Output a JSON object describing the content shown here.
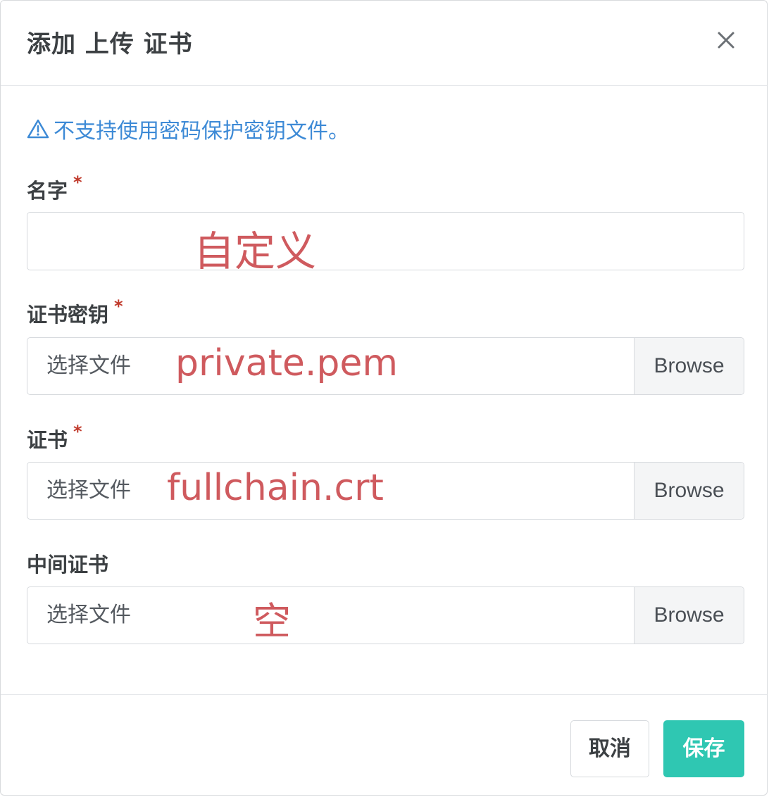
{
  "dialog": {
    "title": "添加 上传 证书",
    "close_icon": "close-icon",
    "warning_text": "不支持使用密码保护密钥文件。",
    "warning_icon": "warning-triangle-icon"
  },
  "fields": {
    "name": {
      "label": "名字",
      "required_mark": "*",
      "value": "",
      "annotation": "自定义"
    },
    "private_key": {
      "label": "证书密钥",
      "required_mark": "*",
      "placeholder": "选择文件",
      "browse_label": "Browse",
      "annotation": "private.pem"
    },
    "certificate": {
      "label": "证书",
      "required_mark": "*",
      "placeholder": "选择文件",
      "browse_label": "Browse",
      "annotation": "fullchain.crt"
    },
    "intermediate": {
      "label": "中间证书",
      "placeholder": "选择文件",
      "browse_label": "Browse",
      "annotation": "空"
    }
  },
  "footer": {
    "cancel_label": "取消",
    "save_label": "保存"
  },
  "colors": {
    "accent": "#2fc7b2",
    "warning": "#3d8ad6",
    "required": "#c0392b",
    "annotation": "#cf5a5e"
  }
}
